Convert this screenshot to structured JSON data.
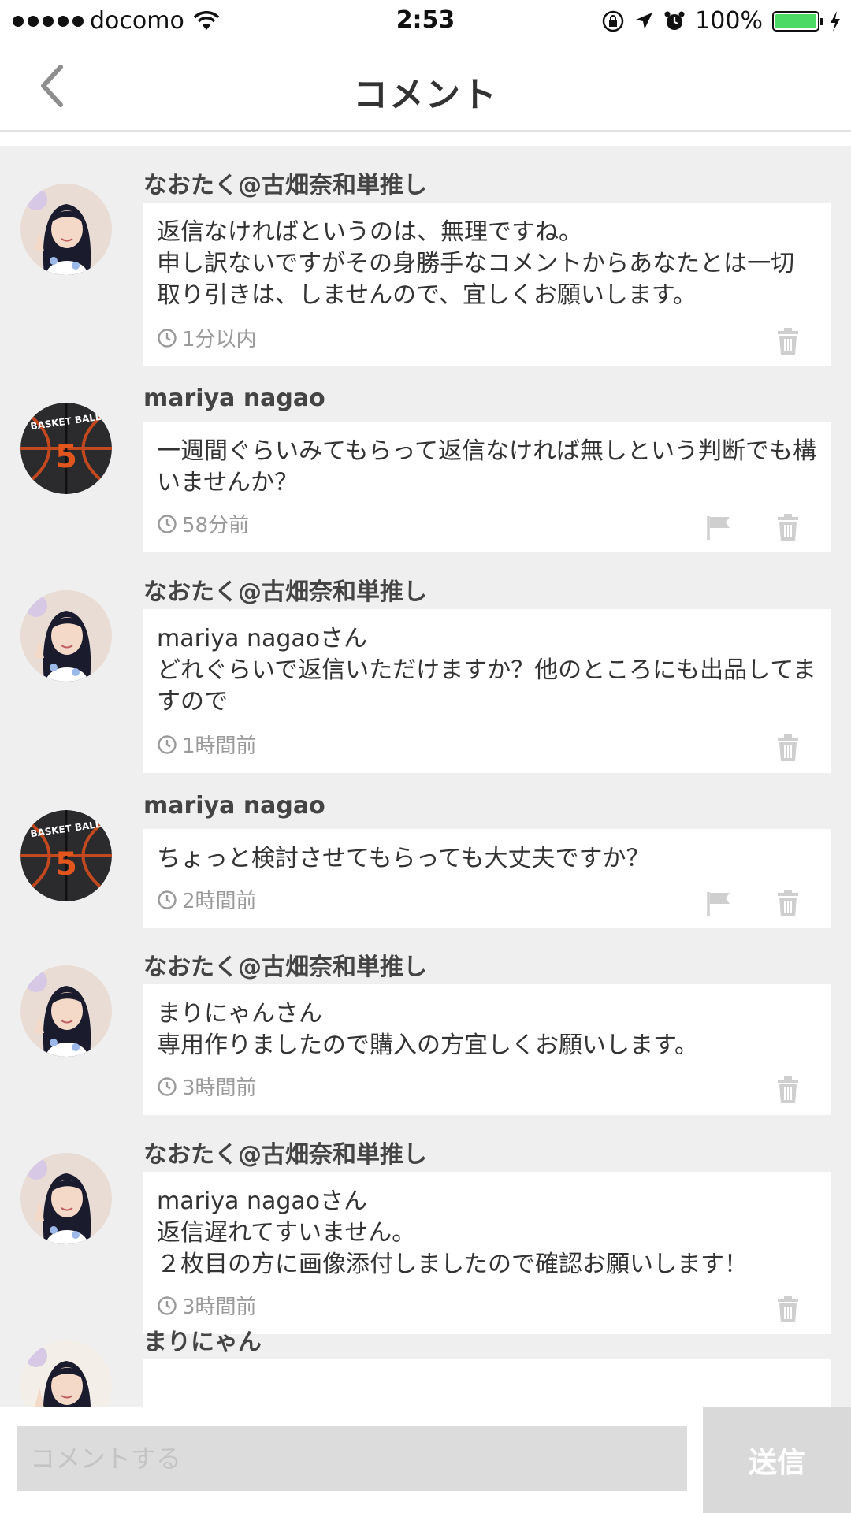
{
  "status_bar": {
    "carrier": "docomo",
    "time": "2:53",
    "battery": "100%",
    "battery_color": "#4cd964"
  },
  "nav": {
    "title": "コメント",
    "back_icon": "chevron-left-icon"
  },
  "comments": [
    {
      "user": "なおたく@古畑奈和単推し",
      "avatar": "girl-photo",
      "text": "返信なければというのは、無理ですね。\n申し訳ないですがその身勝手なコメントからあなたとは一切取り引きは、しませんので、宜しくお願いします。",
      "time": "1分以内",
      "flag": false
    },
    {
      "user": "mariya nagao",
      "avatar": "basketball",
      "text": "一週間ぐらいみてもらって返信なければ無しという判断でも構いませんか？",
      "time": "58分前",
      "flag": true
    },
    {
      "user": "なおたく@古畑奈和単推し",
      "avatar": "girl-photo",
      "text": "mariya nagaoさん\nどれぐらいで返信いただけますか？他のところにも出品してますので",
      "time": "1時間前",
      "flag": false
    },
    {
      "user": "mariya nagao",
      "avatar": "basketball",
      "text": "ちょっと検討させてもらっても大丈夫ですか？",
      "time": "2時間前",
      "flag": true
    },
    {
      "user": "なおたく@古畑奈和単推し",
      "avatar": "girl-photo",
      "text": "まりにゃんさん\n専用作りましたので購入の方宜しくお願いします。",
      "time": "3時間前",
      "flag": false
    },
    {
      "user": "なおたく@古畑奈和単推し",
      "avatar": "girl-photo",
      "text": "mariya nagaoさん\n返信遅れてすいません。\n２枚目の方に画像添付しましたので確認お願いします！",
      "time": "3時間前",
      "flag": false
    },
    {
      "user": "まりにゃん",
      "avatar": "girl-photo-2",
      "text": "",
      "time": "",
      "flag": false
    }
  ],
  "input": {
    "placeholder": "コメントする",
    "send_label": "送信"
  },
  "basketball_label": "BASKET BALL",
  "basketball_number": "5"
}
